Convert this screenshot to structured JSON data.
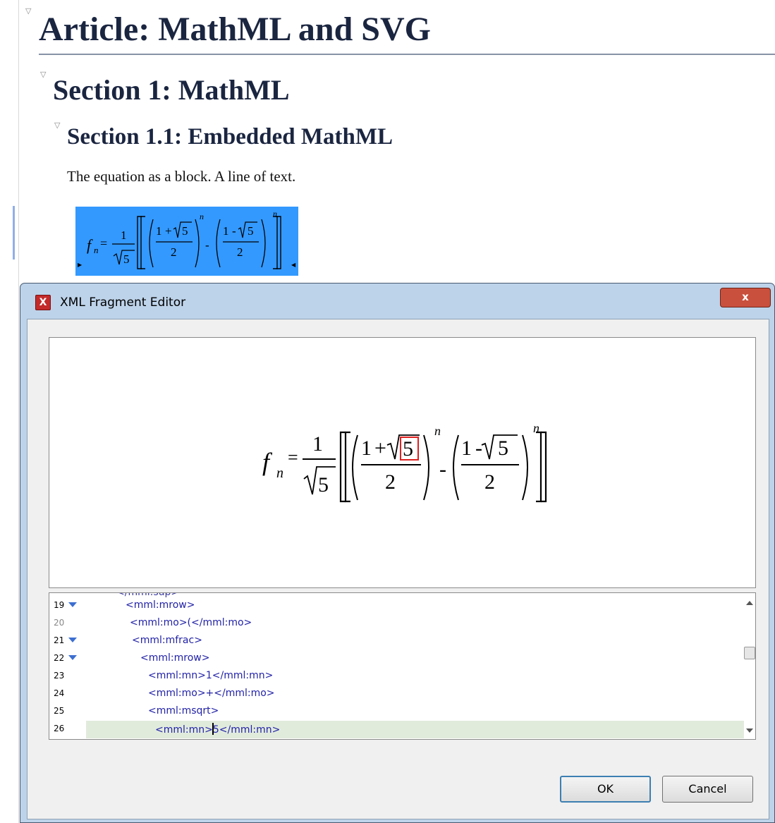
{
  "document": {
    "title": "Article: MathML and SVG",
    "section1": "Section 1: MathML",
    "section11": "Section 1.1: Embedded MathML",
    "paragraph": "The equation as a block. A line of text."
  },
  "equation": {
    "f": "f",
    "sub": "n",
    "eq": "=",
    "one": "1",
    "five": "5",
    "two": "2",
    "plus": "+",
    "minus": "-",
    "exp": "n",
    "lparen": "(",
    "rparen": ")",
    "lbrack": "[",
    "rbrack": "]"
  },
  "dialog": {
    "title": "XML Fragment Editor",
    "close_glyph": "x",
    "app_icon": "X",
    "ok": "OK",
    "cancel": "Cancel"
  },
  "code": {
    "cut_line": "</mml:sup>",
    "lines": [
      {
        "num": "19",
        "text": "<mml:mrow>"
      },
      {
        "num": "20",
        "text": "<mml:mo>(</mml:mo>"
      },
      {
        "num": "21",
        "text": "<mml:mfrac>"
      },
      {
        "num": "22",
        "text": "<mml:mrow>"
      },
      {
        "num": "23",
        "text": "<mml:mn>1</mml:mn>"
      },
      {
        "num": "24",
        "text": "<mml:mo>+</mml:mo>"
      },
      {
        "num": "25",
        "text": "<mml:msqrt>"
      },
      {
        "num": "26",
        "text_before": "<mml:mn>",
        "text_after": "5</mml:mn>"
      }
    ]
  },
  "icons": {
    "collapse": "collapse-triangle-icon",
    "fold": "fold-triangle-icon",
    "app": "xml-editor-app-icon",
    "close": "close-icon",
    "scroll_up": "scroll-up-arrow-icon",
    "scroll_down": "scroll-down-arrow-icon"
  },
  "colors": {
    "heading": "#1a2540",
    "selection": "#3399ff",
    "code_markup": "#2222a8",
    "current_line": "#e1ebdc",
    "sqrt_box": "#e02020",
    "ok_border": "#3c7fb1"
  }
}
